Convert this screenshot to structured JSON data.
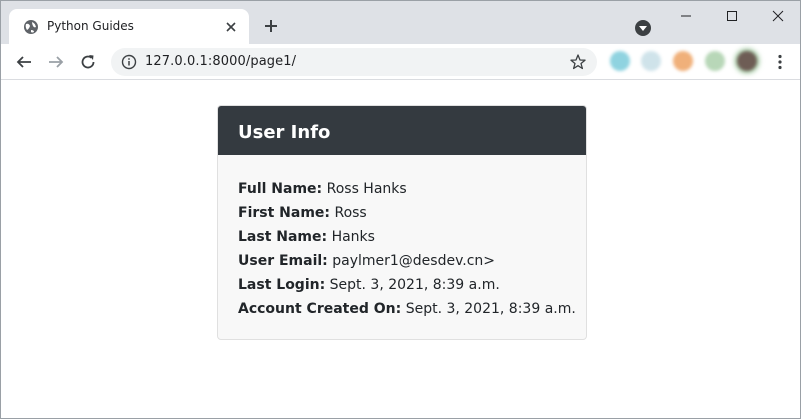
{
  "browser": {
    "tab_title": "Python Guides",
    "url": "127.0.0.1:8000/page1/"
  },
  "card": {
    "title": "User Info",
    "rows": [
      {
        "label": "Full Name:",
        "value": "Ross Hanks"
      },
      {
        "label": "First Name:",
        "value": "Ross"
      },
      {
        "label": "Last Name:",
        "value": "Hanks"
      },
      {
        "label": "User Email:",
        "value": "paylmer1@desdev.cn>"
      },
      {
        "label": "Last Login:",
        "value": "Sept. 3, 2021, 8:39 a.m."
      },
      {
        "label": "Account Created On:",
        "value": "Sept. 3, 2021, 8:39 a.m."
      }
    ]
  },
  "colors": {
    "card_header": "#343a40",
    "tabstrip": "#dee1e6"
  }
}
